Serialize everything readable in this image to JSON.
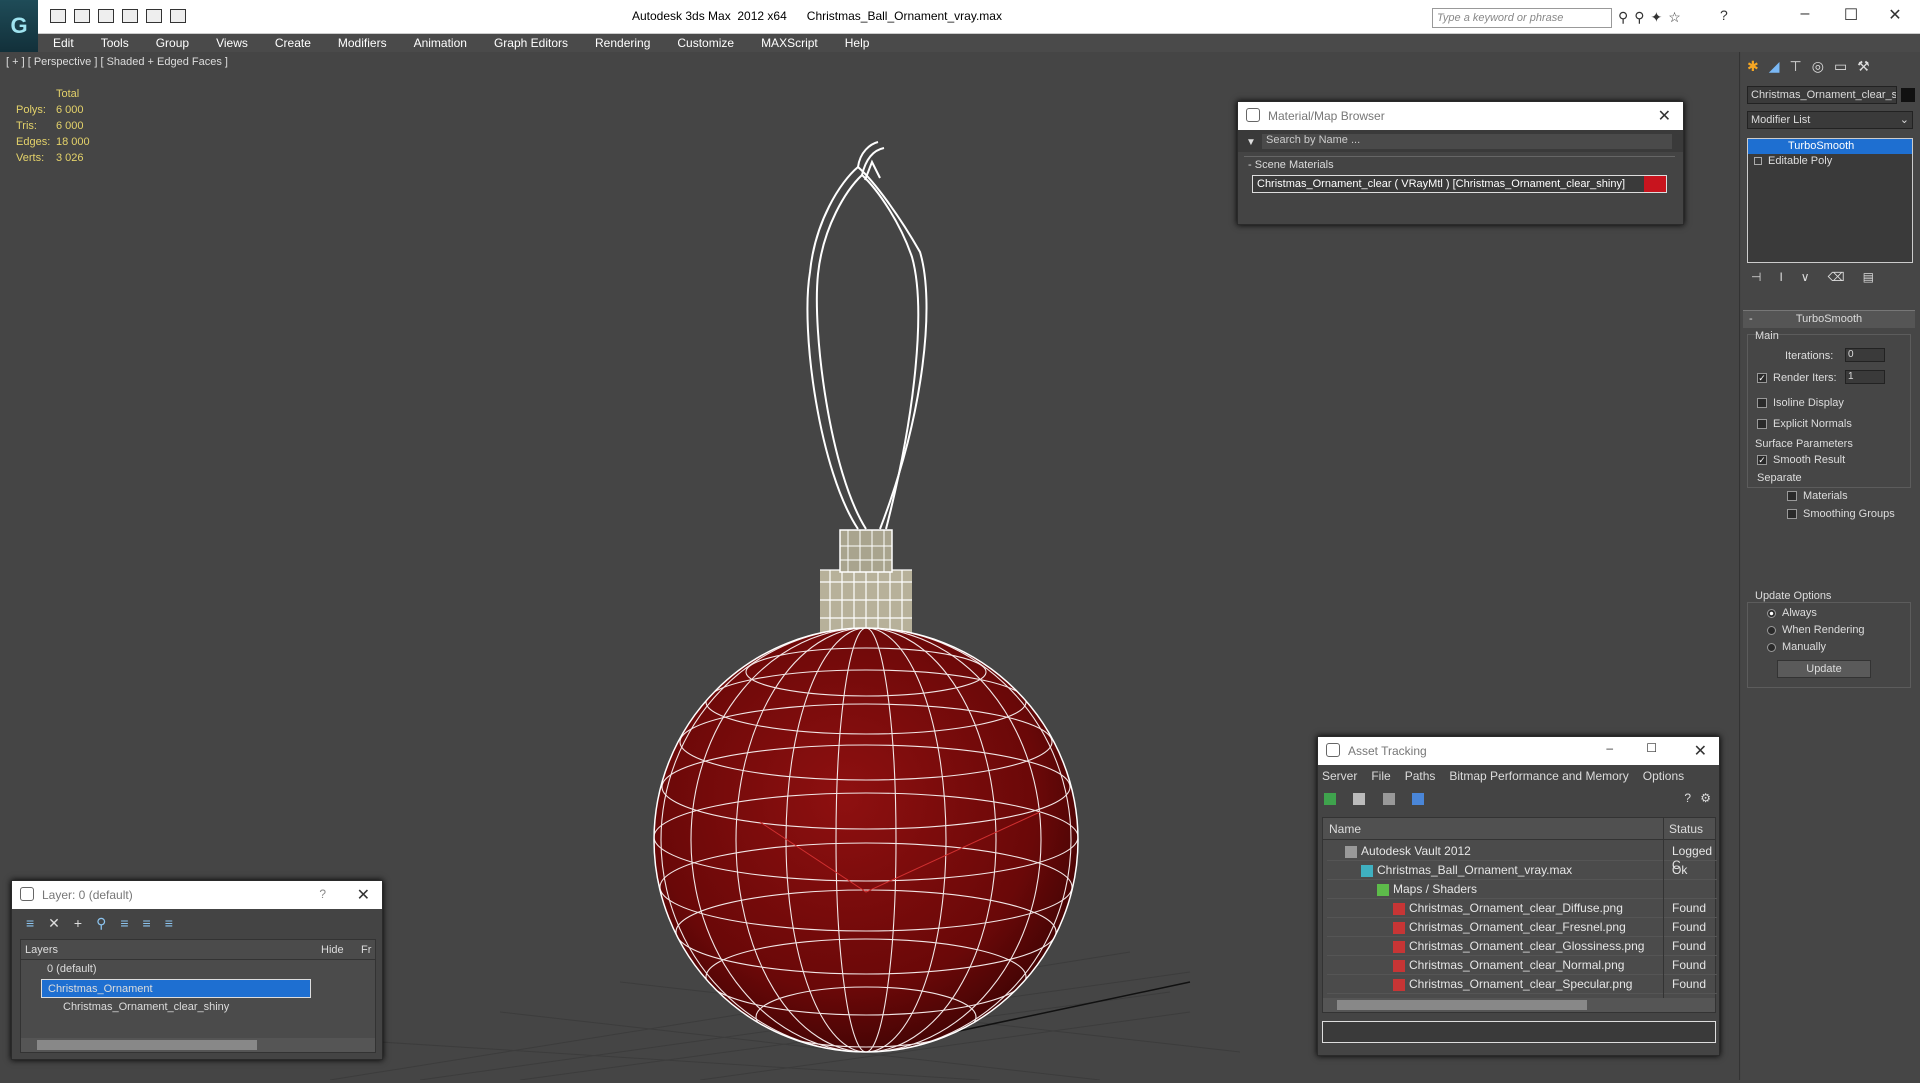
{
  "app": {
    "title": "Autodesk 3ds Max  2012 x64",
    "file": "Christmas_Ball_Ornament_vray.max",
    "search_placeholder": "Type a keyword or phrase",
    "logo": "3ds-max-logo"
  },
  "menu": [
    "Edit",
    "Tools",
    "Group",
    "Views",
    "Create",
    "Modifiers",
    "Animation",
    "Graph Editors",
    "Rendering",
    "Customize",
    "MAXScript",
    "Help"
  ],
  "viewport": {
    "label": "[ + ] [ Perspective ] [ Shaded + Edged Faces ]",
    "stats": {
      "header": "Total",
      "rows": [
        [
          "Polys:",
          "6 000"
        ],
        [
          "Tris:",
          "6 000"
        ],
        [
          "Edges:",
          "18 000"
        ],
        [
          "Verts:",
          "3 026"
        ]
      ]
    }
  },
  "material_browser": {
    "title": "Material/Map Browser",
    "search": "Search by Name ...",
    "section": "Scene Materials",
    "item": "Christmas_Ornament_clear  ( VRayMtl )  [Christmas_Ornament_clear_shiny]"
  },
  "asset_tracking": {
    "title": "Asset Tracking",
    "menu": [
      "Server",
      "File",
      "Paths",
      "Bitmap Performance and Memory",
      "Options"
    ],
    "columns": [
      "Name",
      "Status"
    ],
    "rows": [
      {
        "name": "Autodesk Vault 2012",
        "status": "Logged C",
        "indent": 0,
        "icon": "vault-icon"
      },
      {
        "name": "Christmas_Ball_Ornament_vray.max",
        "status": "Ok",
        "indent": 1,
        "icon": "max-file-icon"
      },
      {
        "name": "Maps / Shaders",
        "status": "",
        "indent": 2,
        "icon": "maps-icon"
      },
      {
        "name": "Christmas_Ornament_clear_Diffuse.png",
        "status": "Found",
        "indent": 3,
        "icon": "png-icon"
      },
      {
        "name": "Christmas_Ornament_clear_Fresnel.png",
        "status": "Found",
        "indent": 3,
        "icon": "png-icon"
      },
      {
        "name": "Christmas_Ornament_clear_Glossiness.png",
        "status": "Found",
        "indent": 3,
        "icon": "png-icon"
      },
      {
        "name": "Christmas_Ornament_clear_Normal.png",
        "status": "Found",
        "indent": 3,
        "icon": "png-icon"
      },
      {
        "name": "Christmas_Ornament_clear_Specular.png",
        "status": "Found",
        "indent": 3,
        "icon": "png-icon"
      }
    ]
  },
  "layers": {
    "title": "Layer: 0 (default)",
    "help": "?",
    "header": "Layers",
    "col_hide": "Hide",
    "col_f": "Fr",
    "rows": [
      {
        "name": "0 (default)",
        "selected": false
      },
      {
        "name": "Christmas_Ornament",
        "selected": true
      },
      {
        "name": "Christmas_Ornament_clear_shiny",
        "selected": false
      }
    ]
  },
  "command_panel": {
    "object_name": "Christmas_Ornament_clear_s",
    "modifier_list": "Modifier List",
    "stack": [
      "TurboSmooth",
      "Editable Poly"
    ],
    "rollout": "TurboSmooth",
    "main": "Main",
    "iterations_label": "Iterations:",
    "iterations": "0",
    "render_iters_label": "Render Iters:",
    "render_iters": "1",
    "isoline": "Isoline Display",
    "explicit": "Explicit Normals",
    "surface": "Surface Parameters",
    "smooth_result": "Smooth Result",
    "separate": "Separate",
    "materials": "Materials",
    "smoothing_groups": "Smoothing Groups",
    "update_options": "Update Options",
    "always": "Always",
    "when_rendering": "When Rendering",
    "manually": "Manually",
    "update_btn": "Update"
  },
  "colors": {
    "ornament": "#7a0a0a",
    "wire": "#ffffff",
    "accent_select": "#1e6fd1",
    "material_swatch": "#c8141e"
  }
}
